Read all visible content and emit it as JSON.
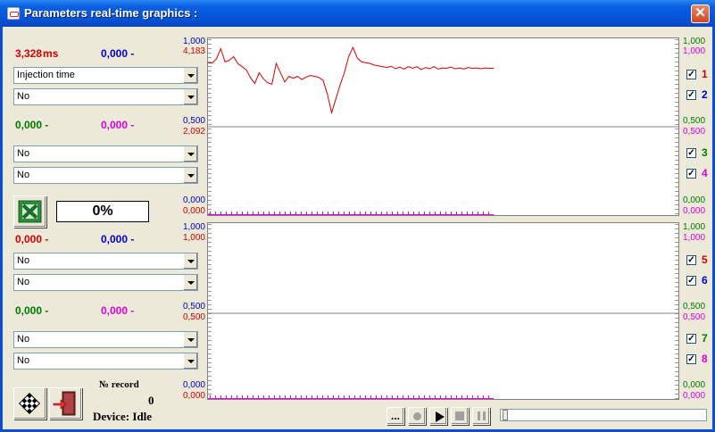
{
  "window": {
    "title": "Parameters real-time graphics :",
    "close_glyph": "✕"
  },
  "group1": {
    "val1": {
      "value": "3,328",
      "unit": "ms"
    },
    "val2": {
      "value": "0,000",
      "unit": "-"
    },
    "combo1": "Injection time",
    "combo2": "No",
    "val3": {
      "value": "0,000",
      "unit": "-"
    },
    "val4": {
      "value": "0,000",
      "unit": "-"
    },
    "combo3": "No",
    "combo4": "No"
  },
  "export": {
    "icon": "excel-icon",
    "progress_text": "0%",
    "progress": 0
  },
  "group2": {
    "val5": {
      "value": "0,000",
      "unit": "-"
    },
    "val6": {
      "value": "0,000",
      "unit": "-"
    },
    "combo5": "No",
    "combo6": "No",
    "val7": {
      "value": "0,000",
      "unit": "-"
    },
    "val8": {
      "value": "0,000",
      "unit": "-"
    },
    "combo7": "No",
    "combo8": "No"
  },
  "footer": {
    "record_label": "№ record",
    "record_value": "0",
    "device_label": "Device:",
    "device_status": "Idle"
  },
  "toolbar": {
    "dots_label": "...",
    "record_icon": "record-icon",
    "play_icon": "play-icon",
    "stop_icon": "stop-icon",
    "pause_icon": "pause-icon",
    "slider_position": 0
  },
  "channels": [
    {
      "num": "1",
      "checked": true,
      "color": "#d60000"
    },
    {
      "num": "2",
      "checked": true,
      "color": "#0000cc"
    },
    {
      "num": "3",
      "checked": true,
      "color": "#007a00"
    },
    {
      "num": "4",
      "checked": true,
      "color": "#e000e0"
    },
    {
      "num": "5",
      "checked": true,
      "color": "#d60000"
    },
    {
      "num": "6",
      "checked": true,
      "color": "#0000cc"
    },
    {
      "num": "7",
      "checked": true,
      "color": "#007a00"
    },
    {
      "num": "8",
      "checked": true,
      "color": "#e000e0"
    }
  ],
  "colors": {
    "ch_red": "#d60000",
    "ch_blue": "#0000cc",
    "ch_green": "#007a00",
    "ch_magenta": "#e000e0"
  },
  "plot1_axes": {
    "left_blue_top": "1,000",
    "left_red_top": "4,183",
    "left_blue_mid": "0,500",
    "left_red_mid": "2,092",
    "left_blue_bot": "0,000",
    "left_red_bot": "0,000",
    "right_green_top": "1,000",
    "right_mag_top": "1,000",
    "right_green_mid": "0,500",
    "right_mag_mid": "0,500",
    "right_green_bot": "0,000",
    "right_mag_bot": "0,000"
  },
  "plot2_axes": {
    "left_blue_top": "1,000",
    "left_red_top": "1,000",
    "left_blue_mid": "0,500",
    "left_red_mid": "0,500",
    "left_blue_bot": "0,000",
    "left_red_bot": "0,000",
    "right_green_top": "1,000",
    "right_mag_top": "1,000",
    "right_green_mid": "0,500",
    "right_mag_mid": "0,500",
    "right_green_bot": "0,000",
    "right_mag_bot": "0,000"
  },
  "chart_data": {
    "type": "line",
    "series": [
      {
        "name": "Injection time",
        "unit": "ms",
        "y": [
          3.8,
          3.79,
          3.9,
          4.15,
          3.82,
          3.86,
          3.95,
          3.78,
          3.7,
          3.62,
          3.42,
          3.28,
          3.55,
          3.4,
          3.3,
          3.26,
          3.78,
          3.55,
          3.32,
          3.46,
          3.41,
          3.46,
          3.38,
          3.44,
          3.48,
          3.46,
          3.43,
          3.36,
          3.02,
          2.55,
          2.9,
          3.25,
          3.55,
          3.95,
          4.18,
          3.92,
          3.82,
          3.8,
          3.78,
          3.74,
          3.72,
          3.7,
          3.68,
          3.71,
          3.65,
          3.69,
          3.64,
          3.7,
          3.66,
          3.7,
          3.63,
          3.68,
          3.65,
          3.7,
          3.64,
          3.67,
          3.66,
          3.69,
          3.65,
          3.67,
          3.64,
          3.68,
          3.66,
          3.67,
          3.65,
          3.67,
          3.66,
          3.66
        ]
      }
    ],
    "ylim": [
      0,
      4.183
    ]
  }
}
